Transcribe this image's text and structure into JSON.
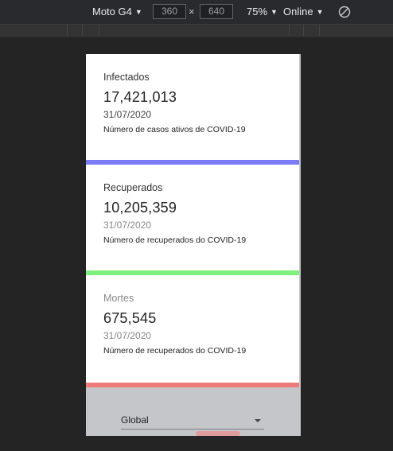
{
  "devtools": {
    "device": "Moto G4",
    "width": "360",
    "height": "640",
    "times": "×",
    "zoom": "75%",
    "throttle": "Online"
  },
  "cards": [
    {
      "label": "Infectados",
      "value": "17,421,013",
      "date": "31/07/2020",
      "description": "Número de casos ativos de COVID-19",
      "bar_color": "#7b7bf5"
    },
    {
      "label": "Recuperados",
      "value": "10,205,359",
      "date": "31/07/2020",
      "description": "Número de recuperados do COVID-19",
      "bar_color": "#7ef07e"
    },
    {
      "label": "Mortes",
      "value": "675,545",
      "date": "31/07/2020",
      "description": "Número de recuperados do COVID-19",
      "bar_color": "#f07b7b"
    }
  ],
  "country_select": {
    "value": "Global"
  },
  "icons": {
    "rotate": "rotate-icon",
    "caret": "caret-down-icon",
    "select_arrow": "chevron-down-icon"
  }
}
